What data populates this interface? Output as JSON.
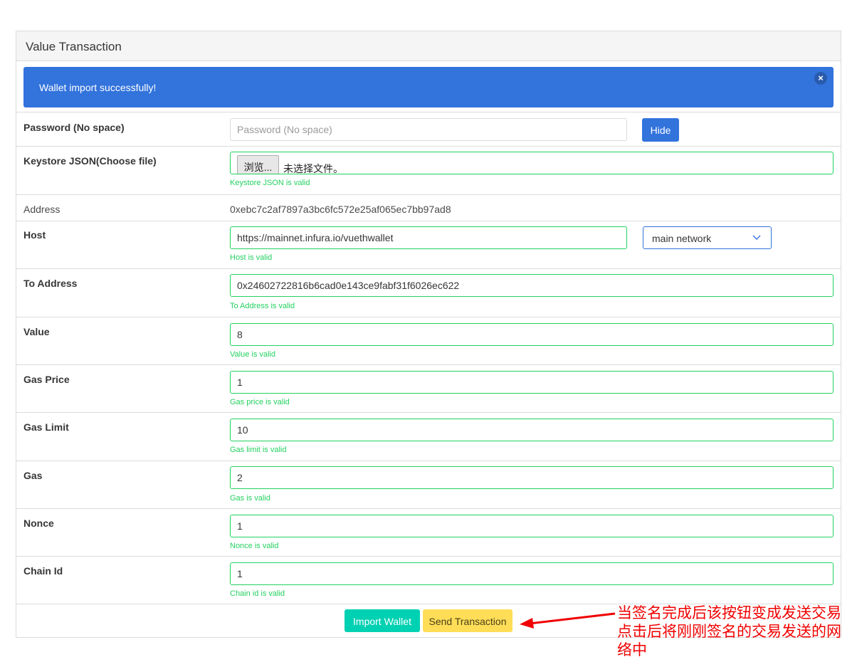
{
  "panel": {
    "title": "Value Transaction"
  },
  "notification": {
    "message": "Wallet import successfully!",
    "close_label": "×"
  },
  "password": {
    "label": "Password (No space)",
    "placeholder": "Password (No space)",
    "hide_label": "Hide"
  },
  "keystore": {
    "label": "Keystore JSON(Choose file)",
    "browse_label": "浏览...",
    "file_status": "未选择文件。",
    "help": "Keystore JSON is valid"
  },
  "address": {
    "label": "Address",
    "value": "0xebc7c2af7897a3bc6fc572e25af065ec7bb97ad8"
  },
  "host": {
    "label": "Host",
    "value": "https://mainnet.infura.io/vuethwallet",
    "help": "Host is valid",
    "network_selected": "main network"
  },
  "to_address": {
    "label": "To Address",
    "value": "0x24602722816b6cad0e143ce9fabf31f6026ec622",
    "help": "To Address is valid"
  },
  "value": {
    "label": "Value",
    "value": "8",
    "help": "Value is valid"
  },
  "gas_price": {
    "label": "Gas Price",
    "value": "1",
    "help": "Gas price is valid"
  },
  "gas_limit": {
    "label": "Gas Limit",
    "value": "10",
    "help": "Gas limit is valid"
  },
  "gas": {
    "label": "Gas",
    "value": "2",
    "help": "Gas is valid"
  },
  "nonce": {
    "label": "Nonce",
    "value": "1",
    "help": "Nonce is valid"
  },
  "chain_id": {
    "label": "Chain Id",
    "value": "1",
    "help": "Chain id is valid"
  },
  "actions": {
    "import_label": "Import Wallet",
    "send_label": "Send Transaction"
  },
  "annotation": {
    "text": "当签名完成后该按钮变成发送交易点击后将刚刚签名的交易发送的网络中"
  },
  "colors": {
    "primary": "#3273dc",
    "success": "#23d160",
    "turquoise": "#00d1b2",
    "warning": "#ffdd57",
    "annotation": "#f00000"
  }
}
